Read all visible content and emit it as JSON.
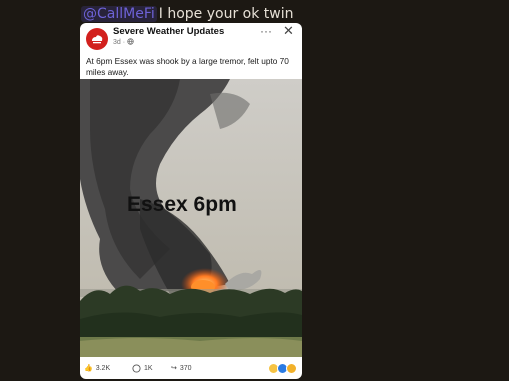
{
  "message": {
    "mention": "@CallMeFi",
    "text": "I hope your ok twin"
  },
  "post": {
    "page_name": "Severe Weather Updates",
    "meta": "3d · ",
    "body": "At 6pm Essex was shook by a large tremor, felt upto 70 miles away.",
    "image_caption": "Essex 6pm",
    "reactions": {
      "likes": "3.2K",
      "comments": "1K",
      "shares": "370"
    }
  },
  "colors": {
    "background": "#1c1813",
    "mention": "#6d62d6",
    "avatar": "#d2201d"
  }
}
